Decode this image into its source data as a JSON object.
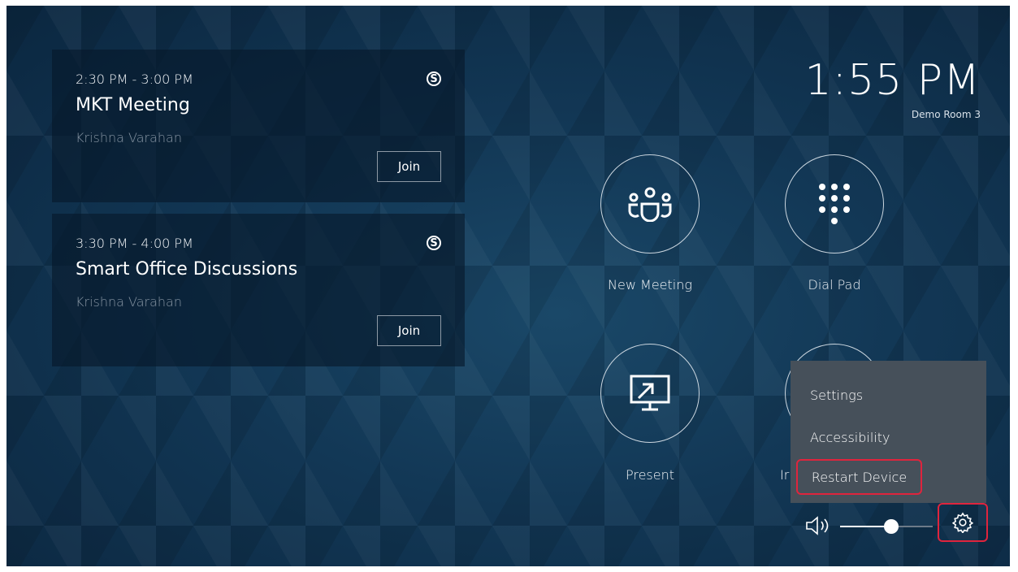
{
  "meetings": [
    {
      "time": "2:30 PM - 3:00 PM",
      "title": "MKT Meeting",
      "organizer": "Krishna Varahan",
      "join_label": "Join",
      "service_icon": "skype-icon"
    },
    {
      "time": "3:30 PM - 4:00 PM",
      "title": "Smart Office Discussions",
      "organizer": "Krishna Varahan",
      "join_label": "Join",
      "service_icon": "skype-icon"
    }
  ],
  "header": {
    "clock": "1:55 PM",
    "room_name": "Demo Room 3"
  },
  "actions": {
    "new_meeting": {
      "label": "New Meeting",
      "icon": "people-icon"
    },
    "dial_pad": {
      "label": "Dial Pad",
      "icon": "dialpad-icon"
    },
    "present": {
      "label": "Present",
      "icon": "present-screen-icon"
    },
    "invite": {
      "label": "Ir",
      "icon": "invite-icon"
    }
  },
  "settings_menu": {
    "items": [
      "Settings",
      "Accessibility",
      "Restart Device"
    ],
    "highlighted": "Restart Device"
  },
  "volume": {
    "level": 0.55
  },
  "colors": {
    "highlight": "#e0243d",
    "menu_bg": "#46505a"
  }
}
